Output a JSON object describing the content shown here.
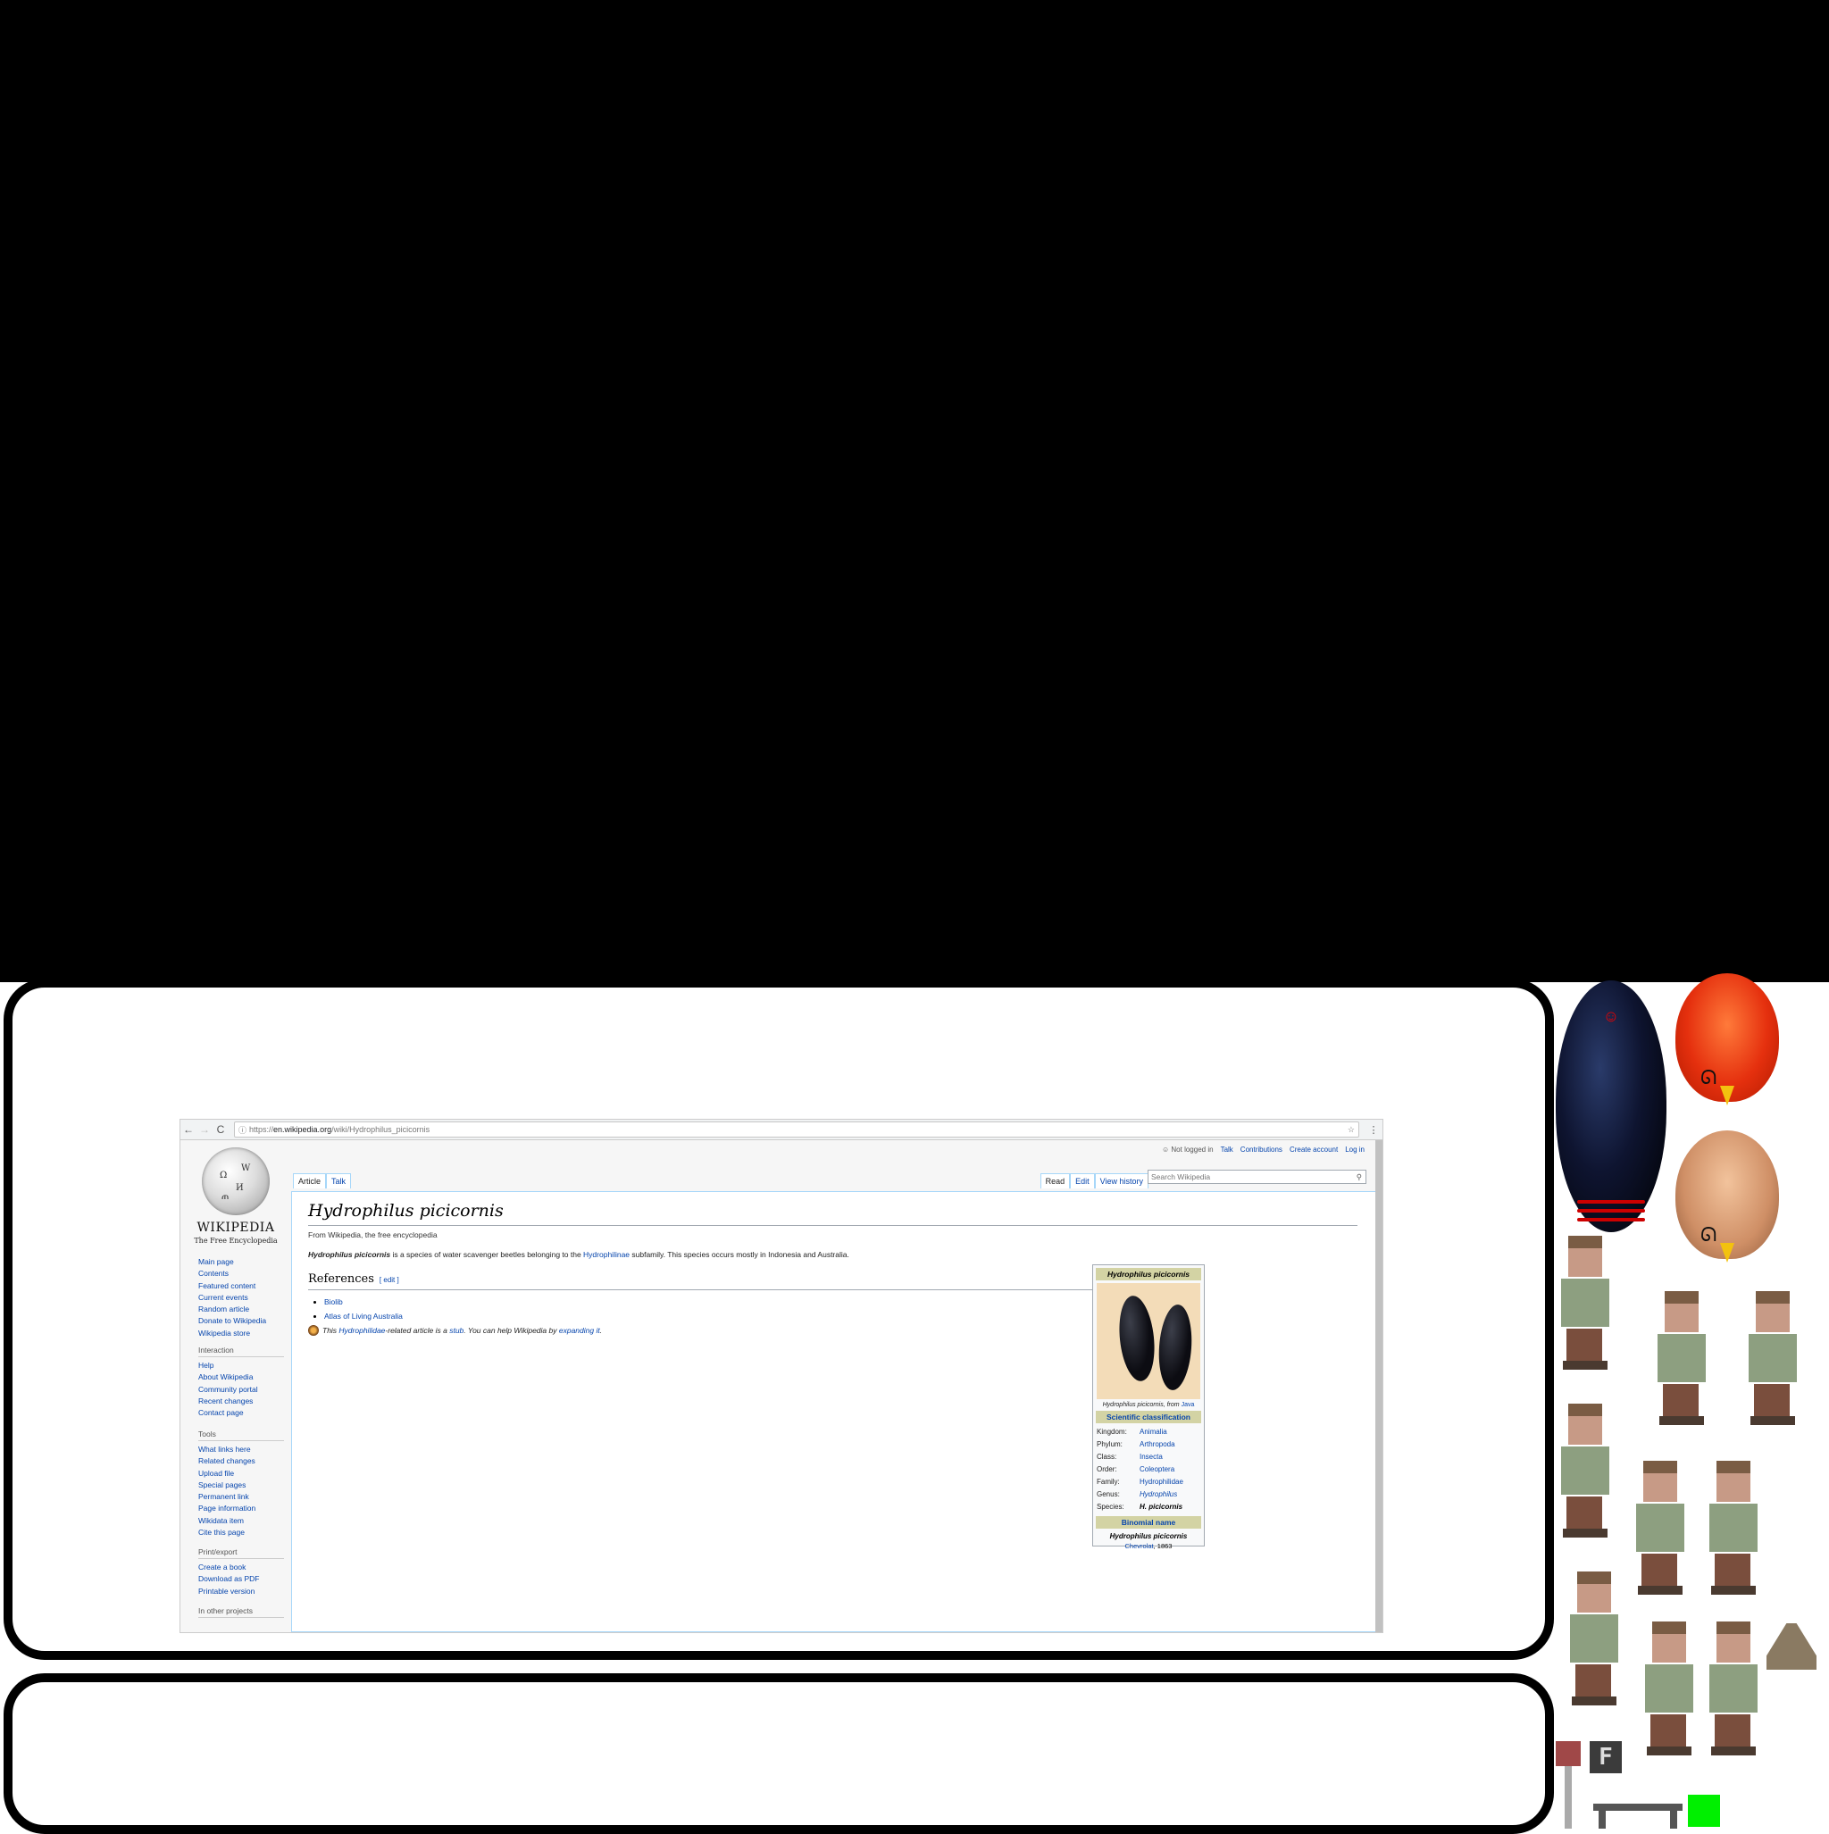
{
  "browser": {
    "url_prefix": "https://",
    "url_domain": "en.wikipedia.org",
    "url_path": "/wiki/Hydrophilus_picicornis",
    "back_icon": "←",
    "forward_icon": "→",
    "reload_icon": "C",
    "info_icon": "ⓘ",
    "star_icon": "☆",
    "menu_icon": "⋮"
  },
  "wiki": {
    "wordmark": "WIKIPEDIA",
    "tagline": "The Free Encyclopedia",
    "top_links": {
      "not_logged_in": "Not logged in",
      "talk": "Talk",
      "contributions": "Contributions",
      "create_account": "Create account",
      "log_in": "Log in"
    },
    "tabs_left": [
      "Article",
      "Talk"
    ],
    "tabs_right": [
      "Read",
      "Edit",
      "View history"
    ],
    "search_placeholder": "Search Wikipedia",
    "sidebar": {
      "nav": [
        "Main page",
        "Contents",
        "Featured content",
        "Current events",
        "Random article",
        "Donate to Wikipedia",
        "Wikipedia store"
      ],
      "interaction_title": "Interaction",
      "interaction": [
        "Help",
        "About Wikipedia",
        "Community portal",
        "Recent changes",
        "Contact page"
      ],
      "tools_title": "Tools",
      "tools": [
        "What links here",
        "Related changes",
        "Upload file",
        "Special pages",
        "Permanent link",
        "Page information",
        "Wikidata item",
        "Cite this page"
      ],
      "print_title": "Print/export",
      "print": [
        "Create a book",
        "Download as PDF",
        "Printable version"
      ],
      "other_title": "In other projects"
    },
    "article": {
      "title": "Hydrophilus picicornis",
      "from": "From Wikipedia, the free encyclopedia",
      "lead_bold": "Hydrophilus picicornis",
      "lead_1": " is a species of water scavenger beetles belonging to the ",
      "lead_link": "Hydrophilinae",
      "lead_2": " subfamily. This species occurs mostly in Indonesia and Australia.",
      "references_heading": "References",
      "edit_link": "[ edit ]",
      "refs": [
        "Biolib",
        "Atlas of Living Australia"
      ],
      "stub_1": "This ",
      "stub_link1": "Hydrophilidae",
      "stub_2": "-related article is a ",
      "stub_link2": "stub",
      "stub_3": ". You can help Wikipedia by ",
      "stub_link3": "expanding it",
      "stub_4": "."
    },
    "infobox": {
      "title": "Hydrophilus picicornis",
      "caption_1": "Hydrophilus picicornis",
      "caption_2": ", from ",
      "caption_link": "Java",
      "sci_heading": "Scientific classification",
      "rows": [
        {
          "k": "Kingdom:",
          "v": "Animalia"
        },
        {
          "k": "Phylum:",
          "v": "Arthropoda"
        },
        {
          "k": "Class:",
          "v": "Insecta"
        },
        {
          "k": "Order:",
          "v": "Coleoptera"
        },
        {
          "k": "Family:",
          "v": "Hydrophilidae"
        },
        {
          "k": "Genus:",
          "v": "Hydrophilus"
        },
        {
          "k": "Species:",
          "v": "H. picicornis"
        }
      ],
      "binomial_heading": "Binomial name",
      "binomial": "Hydrophilus picicornis",
      "authority_link": "Chevrolat",
      "authority_year": ", 1863"
    }
  },
  "decor": {
    "f_key": "F",
    "mustache": "ᘏ"
  }
}
